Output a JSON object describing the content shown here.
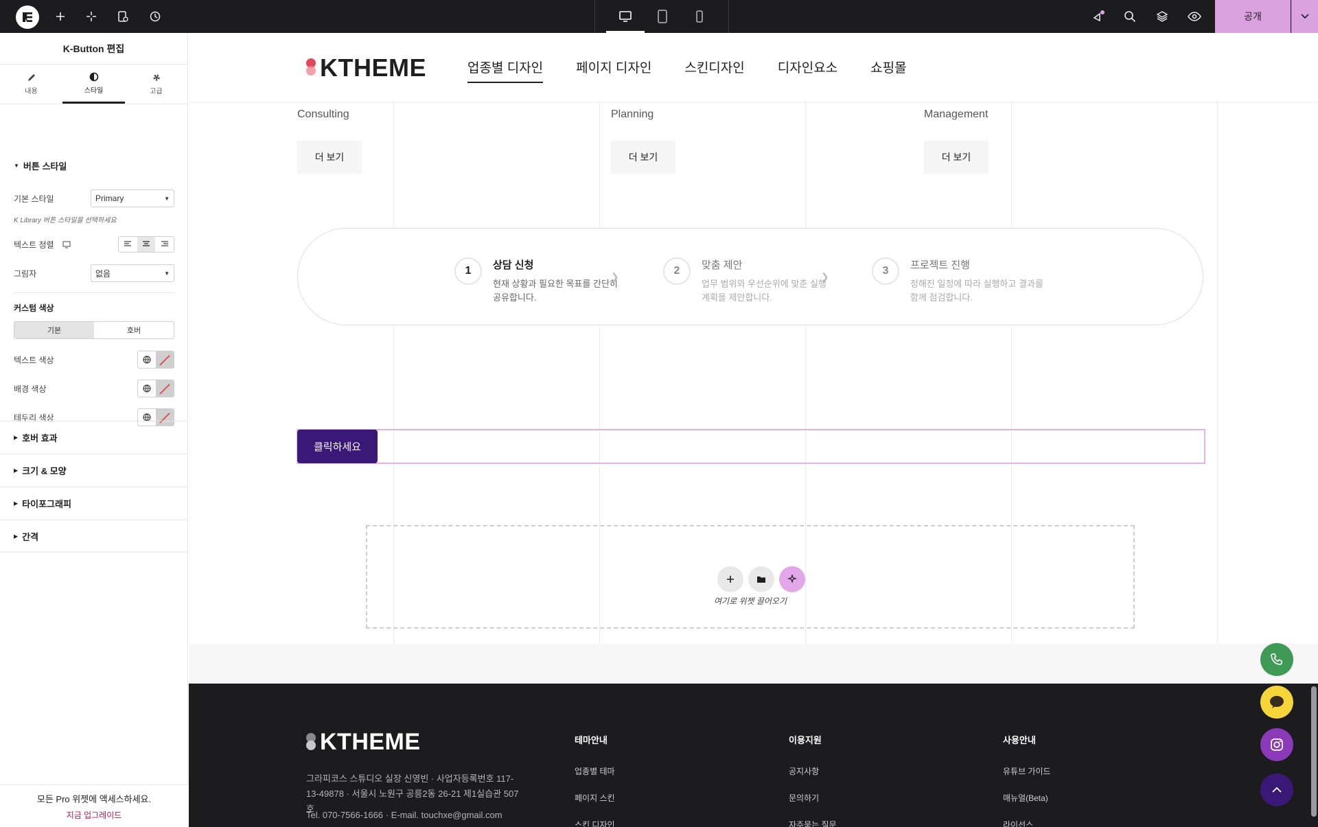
{
  "topbar": {
    "publish_label": "공개",
    "icons": [
      "elementor-logo-icon",
      "add-icon",
      "site-settings-icon",
      "page-settings-icon",
      "history-icon",
      "desktop-icon",
      "tablet-icon",
      "mobile-icon",
      "notifications-icon",
      "search-icon",
      "structure-icon",
      "preview-icon",
      "chevron-down-icon"
    ]
  },
  "panel": {
    "title": "K-Button 편집",
    "tabs": [
      {
        "label": "내용",
        "icon": "pencil-icon"
      },
      {
        "label": "스타일",
        "icon": "contrast-icon"
      },
      {
        "label": "고급",
        "icon": "gear-icon"
      }
    ],
    "section_title": "버튼 스타일",
    "base_style_label": "기본 스타일",
    "base_style_value": "Primary",
    "base_style_hint": "K Library 버튼 스타일을 선택하세요",
    "text_align_label": "텍스트 정렬",
    "shadow_label": "그림자",
    "shadow_value": "없음",
    "custom_color_label": "커스텀 색상",
    "toggle_normal": "기본",
    "toggle_hover": "호버",
    "text_color_label": "텍스트 색상",
    "bg_color_label": "배경 색상",
    "border_color_label": "테두리 색상",
    "collapsed_sections": [
      "호버 효과",
      "크기 & 모양",
      "타이포그래피",
      "간격"
    ],
    "footer_text": "모든 Pro 위젯에 액세스하세요.",
    "footer_link": "지금 업그레이드"
  },
  "site": {
    "logo": "KTHEME",
    "nav": [
      "업종별 디자인",
      "페이지 디자인",
      "스킨디자인",
      "디자인요소",
      "쇼핑몰"
    ],
    "services": [
      "Consulting",
      "Planning",
      "Management"
    ],
    "more_label": "더 보기",
    "steps": [
      {
        "num": "1",
        "title": "상담 신청",
        "desc": "현재 상황과 필요한 목표를 간단히 공유합니다."
      },
      {
        "num": "2",
        "title": "맞춤 제안",
        "desc": "업무 범위와 우선순위에 맞춘 실행 계획을 제안합니다."
      },
      {
        "num": "3",
        "title": "프로젝트 진행",
        "desc": "정해진 일정에 따라 실행하고 결과를 함께 점검합니다."
      }
    ],
    "click_button": "클릭하세요",
    "dropzone_text": "여기로 위젯 끌어오기"
  },
  "footer": {
    "logo": "KTHEME",
    "address": "그라피코스 스튜디오 실장 신영빈 · 사업자등록번호 117-13-49878 · 서울시 노원구 공릉2동 26-21 제1실습관 507호",
    "contact": "Tel. 070-7566-1666 · E-mail. touchxe@gmail.com",
    "columns": [
      {
        "heading": "테마안내",
        "items": [
          "업종별 테마",
          "페이지 스킨",
          "스킨 디자인"
        ]
      },
      {
        "heading": "이용지원",
        "items": [
          "공지사항",
          "문의하기",
          "자주묻는 질문"
        ]
      },
      {
        "heading": "사용안내",
        "items": [
          "유튜브 가이드",
          "매뉴얼(Beta)",
          "라이선스"
        ]
      }
    ]
  },
  "colors": {
    "publish": "#dba2e0",
    "brand_button": "#3a1878",
    "logo_dot_top": "#e2485a",
    "logo_dot_bottom": "#f08a94",
    "phone_fab": "#3f9a55",
    "chat_fab": "#f5d53a",
    "instagram_fab": "#8a3ab9",
    "top_fab": "#3a1878"
  }
}
